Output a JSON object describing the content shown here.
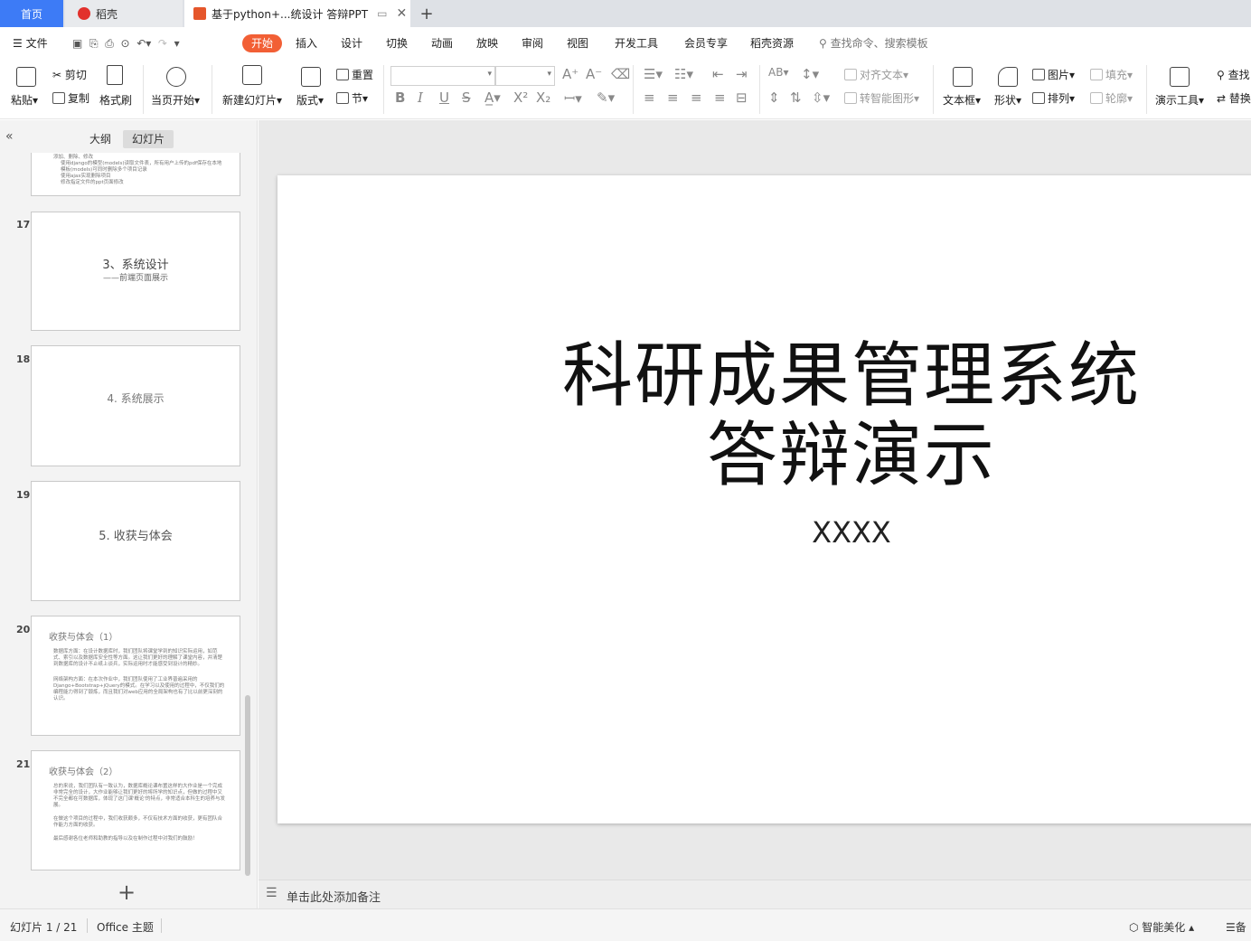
{
  "tabs": {
    "home": "首页",
    "docer": "稻壳",
    "doc": "基于python+...统设计 答辩PPT"
  },
  "colors": {
    "accent": "#f25f35",
    "tab_active": "#3d7bf6",
    "docer_red": "#e2312c",
    "ppt_orange": "#e5562b"
  },
  "menu": {
    "file": "文件",
    "items": [
      "开始",
      "插入",
      "设计",
      "切换",
      "动画",
      "放映",
      "审阅",
      "视图",
      "开发工具",
      "会员专享",
      "稻壳资源"
    ],
    "search": "查找命令、搜索模板"
  },
  "ribbon": {
    "paste": "粘贴",
    "cut": "剪切",
    "copy": "复制",
    "format_painter": "格式刷",
    "play_from_current": "当页开始",
    "new_slide": "新建幻灯片",
    "layout": "版式",
    "reset": "重置",
    "section": "节",
    "align_text": "对齐文本",
    "smart_graphic": "转智能图形",
    "textbox": "文本框",
    "shape": "形状",
    "picture": "图片",
    "arrange": "排列",
    "fill": "填充",
    "outline": "轮廓",
    "present_tools": "演示工具",
    "find": "查找",
    "replace": "替换"
  },
  "panel": {
    "tab_outline": "大纲",
    "tab_slides": "幻灯片"
  },
  "thumbs": {
    "t16": {
      "lines": [
        "添加、删除、修改",
        "使用django的模型(models)读取文件表，所有用户上传的pdf保存在本地",
        "模板(models)可同时删除多个项目记录",
        "使用ajax实现删除项目",
        "修改指定文件的ppt页面修改"
      ]
    },
    "t17": {
      "num": "17",
      "title": "3、系统设计",
      "subtitle": "——前端页面展示"
    },
    "t18": {
      "num": "18",
      "title": "4. 系统展示"
    },
    "t19": {
      "num": "19",
      "title": "5. 收获与体会"
    },
    "t20": {
      "num": "20",
      "title": "收获与体会（1）",
      "p1": "数据库方面：在设计数据库时，我们团队将课堂学到的知识实际运用，如范式、索引以及数据库安全性等方面。这让我们更好的理解了课堂内容，并清楚到数据库的设计不止纸上谈兵，实际运用时才能感受到设计的精妙。",
      "p2": "网络架构方面：在本次作业中，我们团队使用了工业界普遍采用的Django+Bootstrap+jQuery的模式。在学习以及使用的过程中，不仅我们的编程能力得到了锻炼，而且我们对web应用的全局架构也有了比以前更深刻的认识。"
    },
    "t21": {
      "num": "21",
      "title": "收获与体会（2）",
      "p1": "总的来说，我们团队有一致认为，数据库概论课布置这样的大作业是一个完成非常完全的设计，大作业能够让我们更好的将所学的知识点，但做的过程中又不完全都在可数据库，体现了这门课'概论'的特点，非常适合本科生的培养与发展。",
      "p2": "在做这个项目的过程中，我们收获颇多，不仅有技术方面的收获，更有团队合作能力方面的收获。",
      "p3": "最后感谢各位老师和助教的指导以及在制作过程中对我们的鼓励！"
    }
  },
  "slide": {
    "title_line1": "科研成果管理系统",
    "title_line2": "答辩演示",
    "subtitle": "XXXX"
  },
  "notes": {
    "placeholder": "单击此处添加备注"
  },
  "status": {
    "slide_count": "幻灯片 1 / 21",
    "theme": "Office 主题",
    "beautify": "智能美化",
    "notes_btn": "备"
  }
}
